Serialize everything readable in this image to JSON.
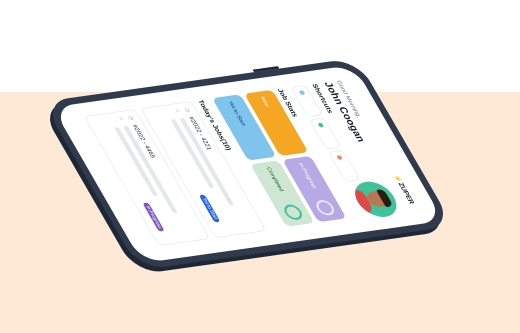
{
  "app": {
    "logo_text": "ZUPER",
    "greeting": "Good Morning,",
    "user_name": "John Coogan"
  },
  "sections": {
    "shortcuts_title": "Shortcuts",
    "job_stats_title": "Job Stats",
    "todays_jobs_title": "Today's Jobs(10)"
  },
  "job_stats": [
    {
      "label": "New",
      "color": "#f5a623"
    },
    {
      "label": "In-Progress",
      "color": "#b7a8e6"
    },
    {
      "label": "Yet to Start",
      "color": "#7fc4ec"
    },
    {
      "label": "Completed",
      "color": "#cfe6d2"
    }
  ],
  "jobs": [
    {
      "id": "#2022 - 4221",
      "status": "Yet to Start",
      "status_color": "#2563eb"
    },
    {
      "id": "#2022 - 4465",
      "status": "In-Progress",
      "status_color": "#7e57c2"
    }
  ],
  "colors": {
    "phone_body": "#2f3a4c",
    "peach_background": "#fde9d6",
    "avatar_ring": "#3ec39a"
  }
}
